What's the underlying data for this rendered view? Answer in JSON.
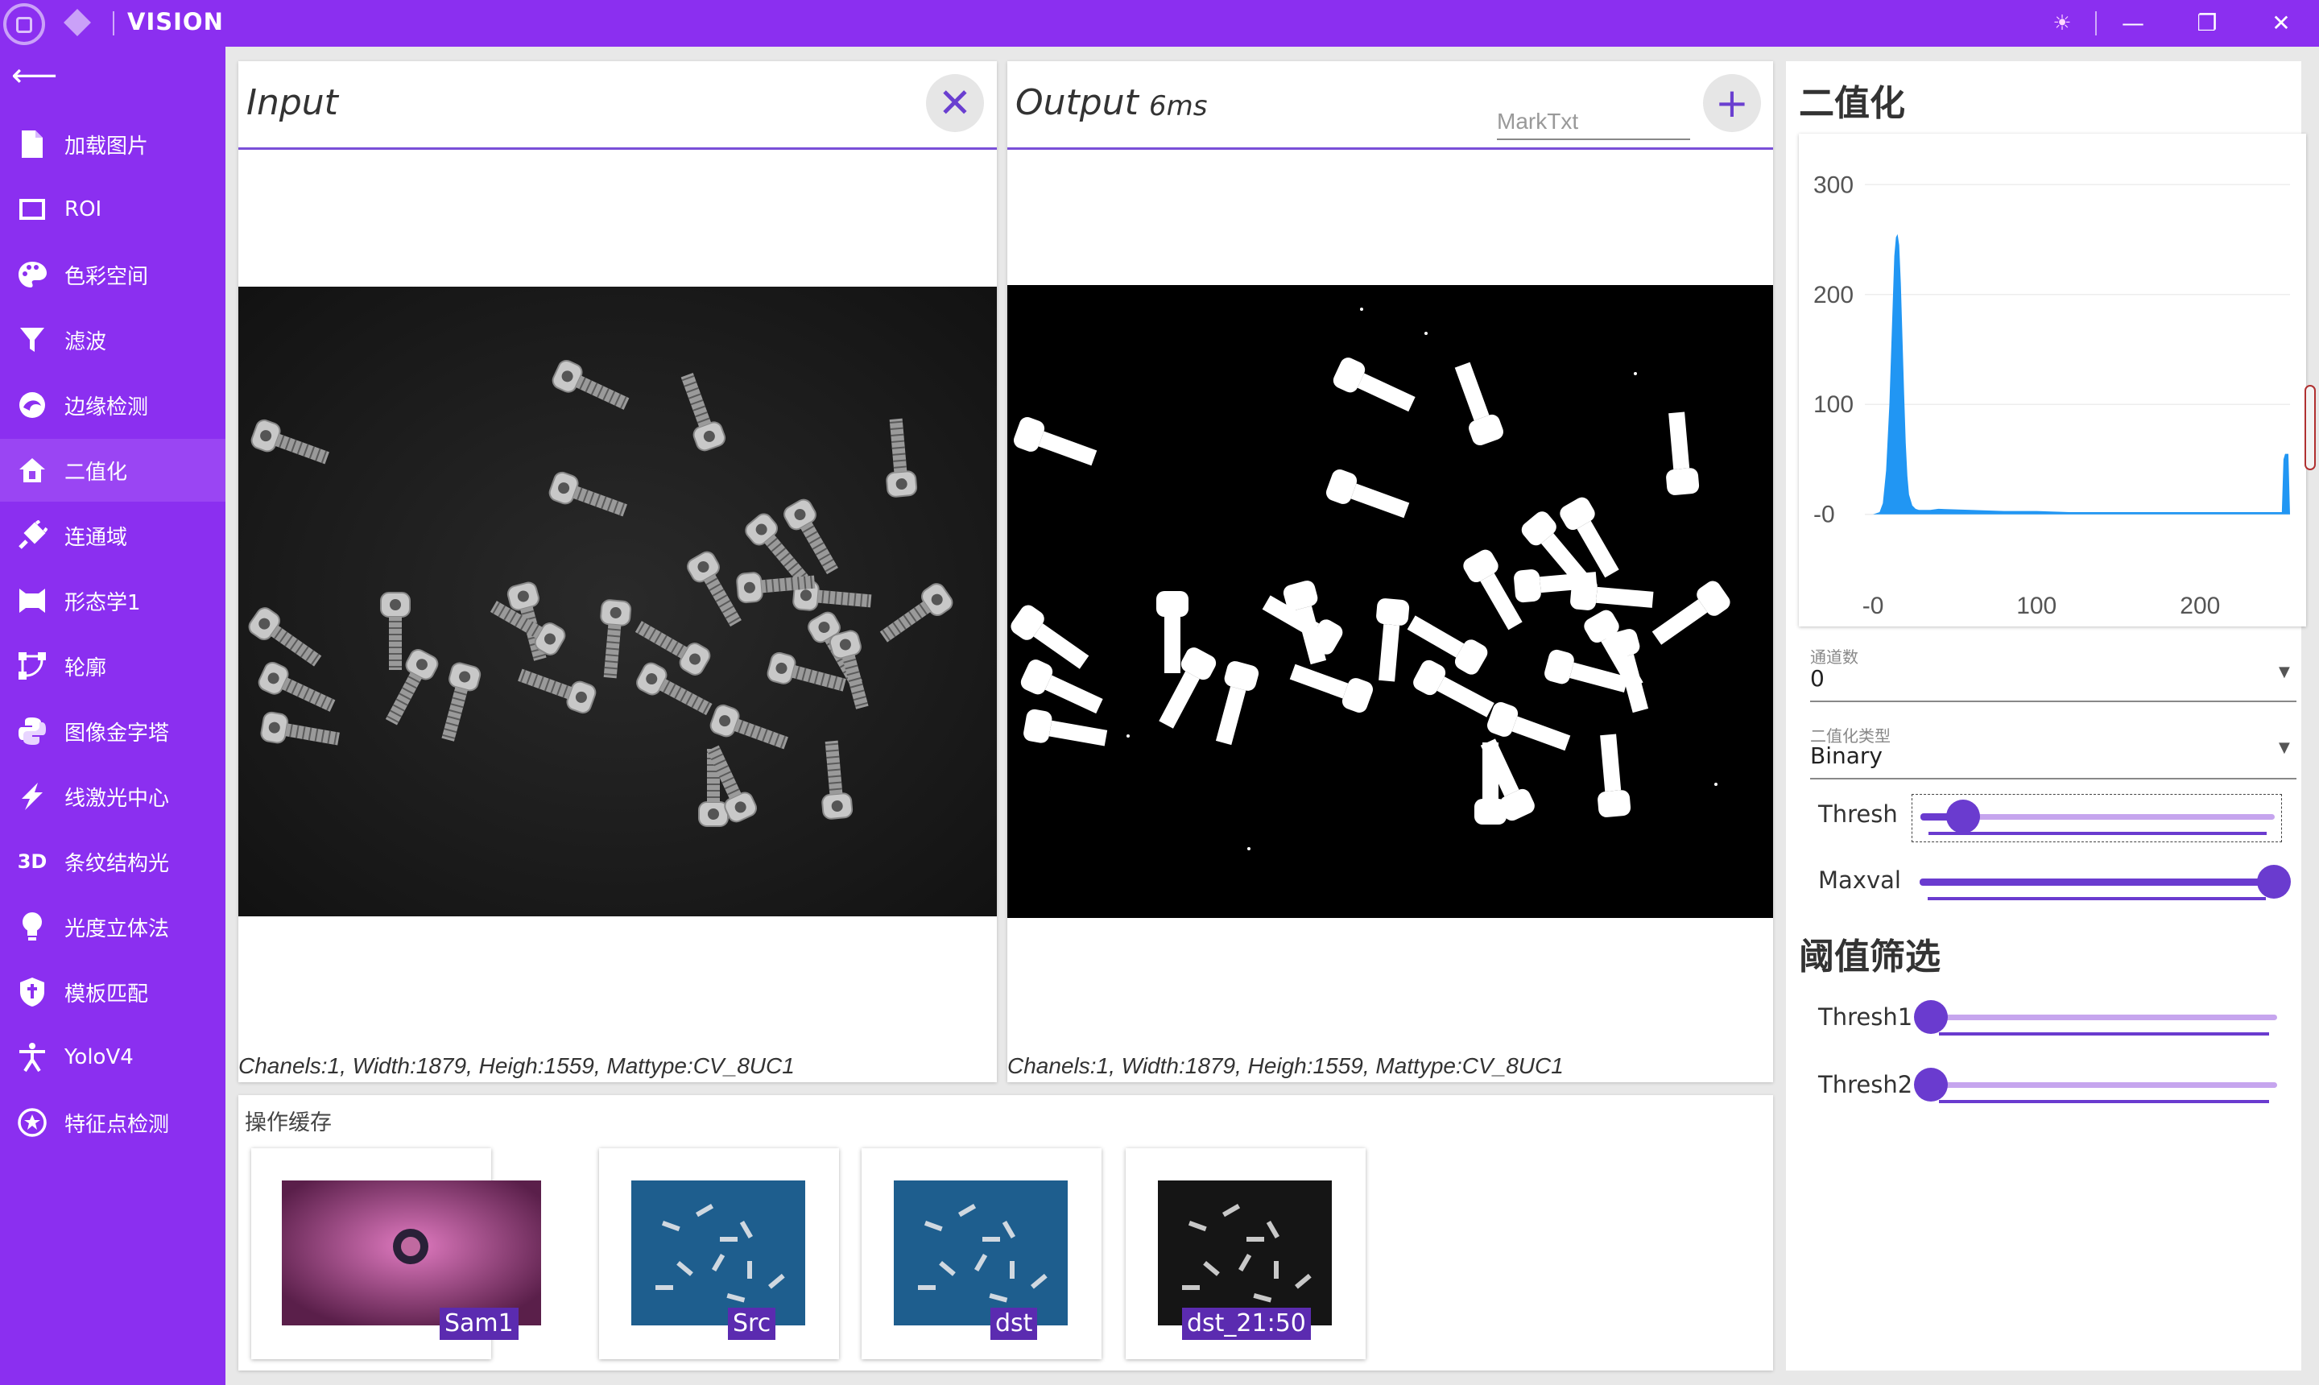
{
  "app": {
    "title": "VISION"
  },
  "window": {
    "theme_icon": "sun-icon",
    "minimize": "—",
    "restore": "❐",
    "close": "✕"
  },
  "sidebar": {
    "items": [
      {
        "label": "加载图片",
        "icon": "file-icon"
      },
      {
        "label": "ROI",
        "icon": "rectangle-icon"
      },
      {
        "label": "色彩空间",
        "icon": "palette-icon"
      },
      {
        "label": "滤波",
        "icon": "filter-icon"
      },
      {
        "label": "边缘检测",
        "icon": "edge-icon"
      },
      {
        "label": "二值化",
        "icon": "home-icon",
        "active": true
      },
      {
        "label": "连通域",
        "icon": "plug-icon"
      },
      {
        "label": "形态学1",
        "icon": "morphology-icon"
      },
      {
        "label": "轮廓",
        "icon": "contour-icon"
      },
      {
        "label": "图像金字塔",
        "icon": "python-icon"
      },
      {
        "label": "线激光中心",
        "icon": "flash-icon"
      },
      {
        "label": "条纹结构光",
        "icon": "3d-icon",
        "glyph": "3D"
      },
      {
        "label": "光度立体法",
        "icon": "lightbulb-icon"
      },
      {
        "label": "模板匹配",
        "icon": "shield-icon"
      },
      {
        "label": "YoloV4",
        "icon": "person-icon"
      },
      {
        "label": "特征点检测",
        "icon": "star-circle-icon"
      }
    ]
  },
  "input_panel": {
    "title": "Input",
    "info": "Chanels:1, Width:1879, Heigh:1559, Mattype:CV_8UC1"
  },
  "output_panel": {
    "title": "Output",
    "time": "6ms",
    "mark_placeholder": "MarkTxt",
    "info": "Chanels:1, Width:1879, Heigh:1559, Mattype:CV_8UC1"
  },
  "cache": {
    "title": "操作缓存",
    "items": [
      {
        "label": "Sam1"
      },
      {
        "label": "Src"
      },
      {
        "label": "dst"
      },
      {
        "label": "dst_21:50"
      }
    ]
  },
  "right_panel": {
    "binarize_title": "二值化",
    "channel": {
      "label": "通道数",
      "value": "0"
    },
    "type": {
      "label": "二值化类型",
      "value": "Binary"
    },
    "thresh": {
      "label": "Thresh",
      "value": 0.12
    },
    "maxval": {
      "label": "Maxval",
      "value": 1.0
    },
    "filter_title": "阈值筛选",
    "thresh1": {
      "label": "Thresh1",
      "value": 0.0
    },
    "thresh2": {
      "label": "Thresh2",
      "value": 0.0
    }
  },
  "chart_data": {
    "type": "area",
    "title": "",
    "xlabel": "",
    "ylabel": "",
    "xlim": [
      -5,
      255
    ],
    "ylim": [
      -20,
      320
    ],
    "x_ticks": [
      "-0",
      "100",
      "200"
    ],
    "y_ticks": [
      "300",
      "200",
      "100",
      "-0"
    ],
    "color": "#2196f3",
    "x": [
      0,
      4,
      6,
      8,
      10,
      12,
      13,
      14,
      15,
      16,
      17,
      18,
      19,
      20,
      21,
      22,
      24,
      26,
      28,
      30,
      35,
      40,
      60,
      80,
      100,
      120,
      140,
      160,
      180,
      200,
      220,
      240,
      250,
      251,
      252,
      253,
      254,
      255
    ],
    "y": [
      0,
      2,
      10,
      40,
      100,
      190,
      235,
      252,
      255,
      245,
      210,
      160,
      110,
      65,
      35,
      18,
      8,
      5,
      4,
      4,
      4,
      5,
      4,
      3,
      3,
      2,
      2,
      2,
      2,
      2,
      2,
      2,
      2,
      50,
      55,
      55,
      55,
      0
    ]
  }
}
